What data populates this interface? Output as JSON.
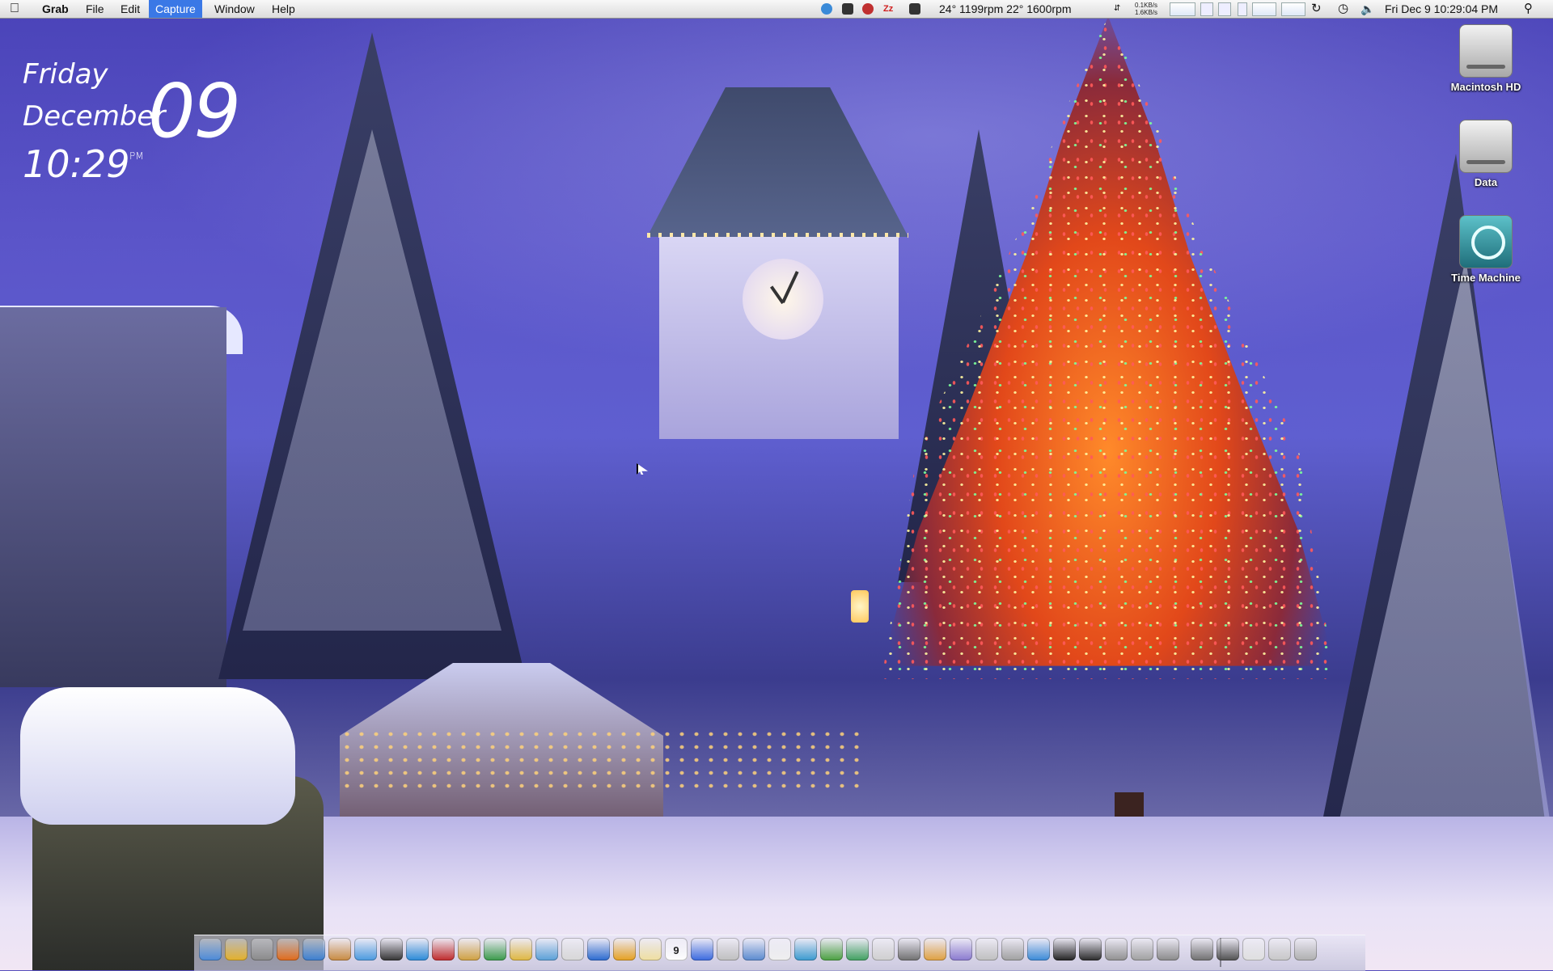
{
  "menubar": {
    "app_name": "Grab",
    "menus": [
      "File",
      "Edit",
      "Capture",
      "Window",
      "Help"
    ],
    "active_menu": "Capture",
    "status": {
      "temps_fans": "24° 1199rpm 22° 1600rpm",
      "net_up": "0.1KB/s",
      "net_down": "1.6KB/s",
      "datetime": "Fri Dec 9  10:29:04 PM"
    },
    "status_icons": [
      "dropbox-icon",
      "terminal-icon",
      "sync-icon",
      "zzz-icon",
      "film-icon",
      "memory-graph-icon",
      "cpu-graph-icon",
      "disk-graph-icon",
      "refresh-icon",
      "time-machine-icon",
      "volume-icon",
      "spotlight-icon"
    ]
  },
  "widget": {
    "day": "Friday",
    "month": "December",
    "date": "09",
    "time": "10:29",
    "ampm": "PM"
  },
  "desktop_icons": [
    {
      "label": "Macintosh HD",
      "icon": "hard-drive-icon"
    },
    {
      "label": "Data",
      "icon": "hard-drive-icon"
    },
    {
      "label": "Time Machine",
      "icon": "time-machine-icon"
    }
  ],
  "dock": {
    "calendar_day": "9",
    "items": [
      {
        "icon": "finder-icon",
        "color": "#4a8ad8"
      },
      {
        "icon": "chrome-icon",
        "color": "#e3b02a"
      },
      {
        "icon": "preview-icon",
        "color": "#8a8a8a"
      },
      {
        "icon": "firefox-icon",
        "color": "#e06a1a"
      },
      {
        "icon": "itunes-icon",
        "color": "#3b7fd0"
      },
      {
        "icon": "photo-icon",
        "color": "#c98a40"
      },
      {
        "icon": "safari-icon",
        "color": "#4a9ae0"
      },
      {
        "icon": "camera-icon",
        "color": "#333333"
      },
      {
        "icon": "photoshop-elements-icon",
        "color": "#2a8ad8"
      },
      {
        "icon": "acrobat-icon",
        "color": "#c02a2a"
      },
      {
        "icon": "paint-icon",
        "color": "#d0a040"
      },
      {
        "icon": "spreadsheet-icon",
        "color": "#3a9a4a"
      },
      {
        "icon": "sketch-icon",
        "color": "#e0b840"
      },
      {
        "icon": "fish-icon",
        "color": "#5aa0d8"
      },
      {
        "icon": "notes-icon",
        "color": "#d8d8d8"
      },
      {
        "icon": "word-icon",
        "color": "#2a6ad0"
      },
      {
        "icon": "outlook-icon",
        "color": "#e6a020"
      },
      {
        "icon": "notepad-icon",
        "color": "#f0e0a0"
      },
      {
        "icon": "calendar-icon",
        "color": "#ffffff"
      },
      {
        "icon": "messenger-icon",
        "color": "#3a6ae0"
      },
      {
        "icon": "mail-icon",
        "color": "#c0c0c0"
      },
      {
        "icon": "ichat-icon",
        "color": "#5a8ad0"
      },
      {
        "icon": "textedit-icon",
        "color": "#f0f0f0"
      },
      {
        "icon": "dashboard-icon",
        "color": "#3a9ad0"
      },
      {
        "icon": "utorrent-icon",
        "color": "#4aa040"
      },
      {
        "icon": "syncmate-icon",
        "color": "#40a060"
      },
      {
        "icon": "dvd-icon",
        "color": "#d0d0d0"
      },
      {
        "icon": "tools-icon",
        "color": "#707070"
      },
      {
        "icon": "headphones-icon",
        "color": "#e0a040"
      },
      {
        "icon": "folder-icon",
        "color": "#8a7ad0"
      },
      {
        "icon": "script-icon",
        "color": "#c0c0c0"
      },
      {
        "icon": "disk-utility-icon",
        "color": "#a0a0a0"
      },
      {
        "icon": "app-store-icon",
        "color": "#3a8ad8"
      },
      {
        "icon": "terminal-icon",
        "color": "#222222"
      },
      {
        "icon": "activity-monitor-icon",
        "color": "#2a2a2a"
      },
      {
        "icon": "system-icon",
        "color": "#909090"
      },
      {
        "icon": "printer-icon",
        "color": "#a0a0a0"
      },
      {
        "icon": "system-preferences-icon",
        "color": "#8a8a8a"
      },
      {
        "icon": "downloads-stack-icon",
        "color": "#707070"
      },
      {
        "icon": "music-stack-icon",
        "color": "#505050"
      },
      {
        "icon": "documents-stack-icon",
        "color": "#e0e0e0"
      },
      {
        "icon": "mail-stack-icon",
        "color": "#c8c8c8"
      },
      {
        "icon": "trash-icon",
        "color": "#b0b0b0"
      }
    ]
  }
}
